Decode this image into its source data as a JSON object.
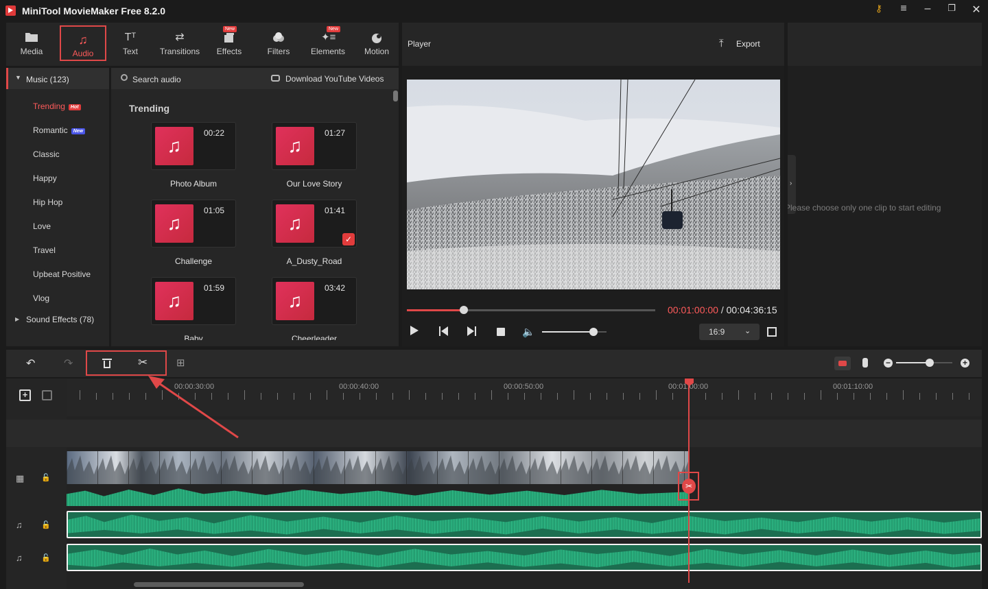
{
  "window": {
    "title": "MiniTool MovieMaker Free 8.2.0",
    "icons": [
      "key-icon",
      "menu-icon",
      "minimize-icon",
      "maximize-icon",
      "close-icon"
    ]
  },
  "toolbar": {
    "items": [
      {
        "label": "Media",
        "icon": "folder-icon",
        "active": false
      },
      {
        "label": "Audio",
        "icon": "music-note-icon",
        "active": true
      },
      {
        "label": "Text",
        "icon": "text-icon",
        "active": false
      },
      {
        "label": "Transitions",
        "icon": "swap-arrows-icon",
        "active": false
      },
      {
        "label": "Effects",
        "icon": "effects-icon",
        "active": false,
        "badge": "New"
      },
      {
        "label": "Filters",
        "icon": "filters-icon",
        "active": false
      },
      {
        "label": "Elements",
        "icon": "elements-icon",
        "active": false,
        "badge": "New"
      },
      {
        "label": "Motion",
        "icon": "motion-icon",
        "active": false
      }
    ]
  },
  "sidebar": {
    "music_group": "Music (123)",
    "categories": [
      {
        "label": "Trending",
        "badge": "Hot",
        "badge_color": "#e23c3c",
        "active": true
      },
      {
        "label": "Romantic",
        "badge": "New",
        "badge_color": "#4a56e8"
      },
      {
        "label": "Classic"
      },
      {
        "label": "Happy"
      },
      {
        "label": "Hip Hop"
      },
      {
        "label": "Love"
      },
      {
        "label": "Travel"
      },
      {
        "label": "Upbeat Positive"
      },
      {
        "label": "Vlog"
      }
    ],
    "sound_effects_group": "Sound Effects (78)"
  },
  "audio_panel": {
    "search_placeholder": "Search audio",
    "download_label": "Download YouTube Videos",
    "section_title": "Trending",
    "tracks": [
      {
        "title": "Photo Album",
        "duration": "00:22"
      },
      {
        "title": "Our Love Story",
        "duration": "01:27"
      },
      {
        "title": "Challenge",
        "duration": "01:05"
      },
      {
        "title": "A_Dusty_Road",
        "duration": "01:41",
        "added": true
      },
      {
        "title": "Baby",
        "duration": "01:59"
      },
      {
        "title": "Cheerleader",
        "duration": "03:42"
      }
    ]
  },
  "player": {
    "label": "Player",
    "export_label": "Export",
    "current_time": "00:01:00:00",
    "separator": " / ",
    "total_time": "00:04:36:15",
    "progress": 0.23,
    "volume": 0.8,
    "aspect_ratio": "16:9"
  },
  "properties": {
    "placeholder": "Please choose only one clip to start editing"
  },
  "timeline": {
    "ruler_labels": [
      "00:00:30:00",
      "00:00:40:00",
      "00:00:50:00",
      "00:01:00:00",
      "00:01:10:00"
    ],
    "playhead_time": "00:01:00:00",
    "zoom_level": 0.6,
    "accent_color": "#e04848",
    "audio_color": "#2bb080"
  }
}
